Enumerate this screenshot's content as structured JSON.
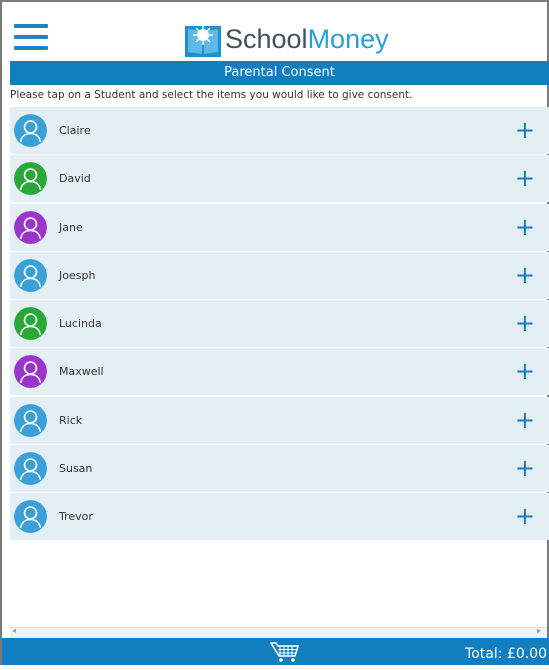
{
  "app": {
    "logo_part1": "School",
    "logo_part2": "Money"
  },
  "page": {
    "title": "Parental Consent",
    "instruction": "Please tap on a Student and select the items you would like to give consent."
  },
  "students": [
    {
      "name": "Claire",
      "avatar_color": "#3aa0d8"
    },
    {
      "name": "David",
      "avatar_color": "#2aa837"
    },
    {
      "name": "Jane",
      "avatar_color": "#9a35c9"
    },
    {
      "name": "Joesph",
      "avatar_color": "#3aa0d8"
    },
    {
      "name": "Lucinda",
      "avatar_color": "#2aa837"
    },
    {
      "name": "Maxwell",
      "avatar_color": "#9a35c9"
    },
    {
      "name": "Rick",
      "avatar_color": "#3aa0d8"
    },
    {
      "name": "Susan",
      "avatar_color": "#3aa0d8"
    },
    {
      "name": "Trevor",
      "avatar_color": "#3aa0d8"
    }
  ],
  "add_symbol": "+",
  "footer": {
    "total_label": "Total: £0.00",
    "cart_icon": "cart-icon"
  },
  "colors": {
    "brand_blue": "#117ec0",
    "row_bg": "#e3eef5"
  }
}
